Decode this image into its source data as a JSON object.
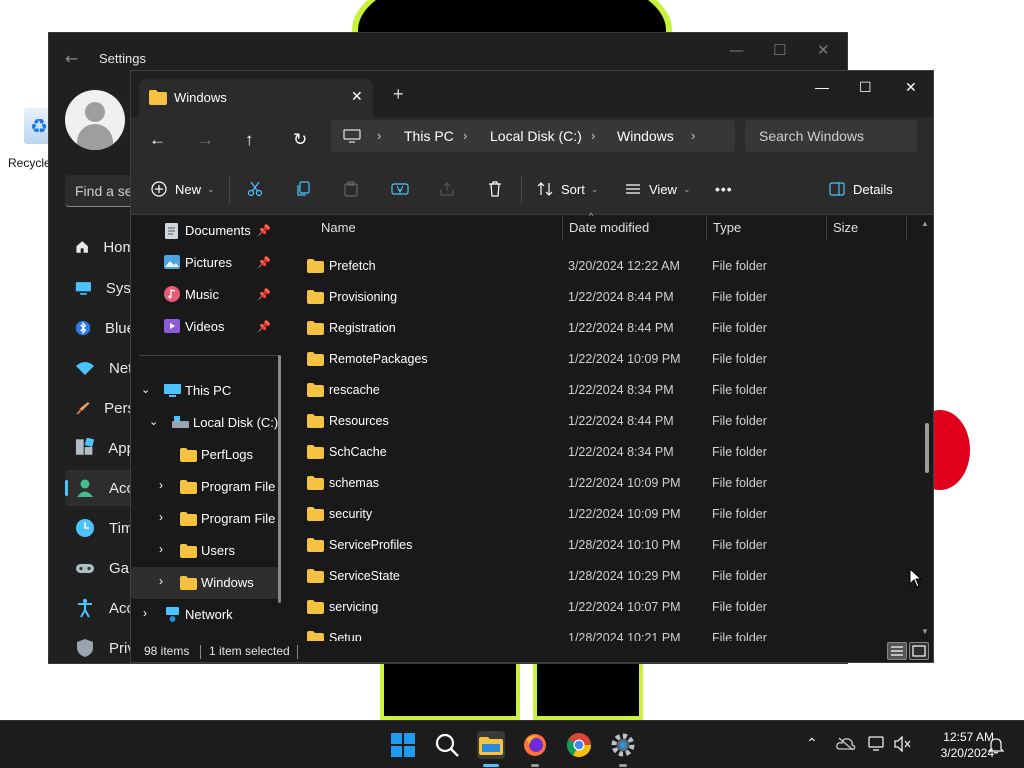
{
  "desktop": {
    "recycle_bin_label": "Recycle"
  },
  "settings": {
    "title": "Settings",
    "find_placeholder": "Find a se",
    "nav": [
      {
        "label": "Hom",
        "icon": "home-icon"
      },
      {
        "label": "Syst",
        "icon": "system-icon"
      },
      {
        "label": "Blue",
        "icon": "bluetooth-icon"
      },
      {
        "label": "Net",
        "icon": "wifi-icon"
      },
      {
        "label": "Pers",
        "icon": "brush-icon"
      },
      {
        "label": "App",
        "icon": "apps-icon"
      },
      {
        "label": "Acc",
        "icon": "accounts-icon"
      },
      {
        "label": "Tim",
        "icon": "time-language-icon"
      },
      {
        "label": "Gar",
        "icon": "gaming-icon"
      },
      {
        "label": "Acc",
        "icon": "accessibility-icon"
      },
      {
        "label": "Priv",
        "icon": "privacy-shield-icon"
      }
    ],
    "active_index": 6
  },
  "explorer": {
    "tab": {
      "title": "Windows",
      "close": "✕"
    },
    "new_tab": "+",
    "window_controls": {
      "minimize": "—",
      "maximize": "☐",
      "close": "✕"
    },
    "breadcrumbs": [
      "This PC",
      "Local Disk (C:)",
      "Windows"
    ],
    "search_placeholder": "Search Windows",
    "toolbar": {
      "new_label": "New",
      "sort_label": "Sort",
      "view_label": "View",
      "more_label": "•••",
      "details_label": "Details"
    },
    "nav_pane": {
      "quick_access": [
        {
          "label": "Documents",
          "icon": "documents-icon"
        },
        {
          "label": "Pictures",
          "icon": "pictures-icon"
        },
        {
          "label": "Music",
          "icon": "music-icon"
        },
        {
          "label": "Videos",
          "icon": "videos-icon"
        }
      ],
      "this_pc": "This PC",
      "local_disk": "Local Disk (C:)",
      "folders": [
        "PerfLogs",
        "Program File",
        "Program File",
        "Users",
        "Windows"
      ],
      "network": "Network"
    },
    "columns": {
      "name": "Name",
      "date": "Date modified",
      "type": "Type",
      "size": "Size"
    },
    "rows": [
      {
        "name": "Prefetch",
        "date": "3/20/2024 12:22 AM",
        "type": "File folder"
      },
      {
        "name": "Provisioning",
        "date": "1/22/2024 8:44 PM",
        "type": "File folder"
      },
      {
        "name": "Registration",
        "date": "1/22/2024 8:44 PM",
        "type": "File folder"
      },
      {
        "name": "RemotePackages",
        "date": "1/22/2024 10:09 PM",
        "type": "File folder"
      },
      {
        "name": "rescache",
        "date": "1/22/2024 8:34 PM",
        "type": "File folder"
      },
      {
        "name": "Resources",
        "date": "1/22/2024 8:44 PM",
        "type": "File folder"
      },
      {
        "name": "SchCache",
        "date": "1/22/2024 8:34 PM",
        "type": "File folder"
      },
      {
        "name": "schemas",
        "date": "1/22/2024 10:09 PM",
        "type": "File folder"
      },
      {
        "name": "security",
        "date": "1/22/2024 10:09 PM",
        "type": "File folder"
      },
      {
        "name": "ServiceProfiles",
        "date": "1/28/2024 10:10 PM",
        "type": "File folder"
      },
      {
        "name": "ServiceState",
        "date": "1/28/2024 10:29 PM",
        "type": "File folder"
      },
      {
        "name": "servicing",
        "date": "1/22/2024 10:07 PM",
        "type": "File folder"
      },
      {
        "name": "Setup",
        "date": "1/28/2024 10:21 PM",
        "type": "File folder"
      }
    ],
    "status": {
      "item_count": "98 items",
      "selection": "1 item selected"
    }
  },
  "taskbar": {
    "apps": [
      "start-icon",
      "search-icon",
      "file-explorer-icon",
      "firefox-icon",
      "chrome-icon",
      "settings-gear-icon"
    ],
    "clock_time": "12:57 AM",
    "clock_date": "3/20/2024"
  },
  "colors": {
    "accent": "#4cc2ff",
    "folder": "#f6c242",
    "window_bg": "#191919"
  }
}
